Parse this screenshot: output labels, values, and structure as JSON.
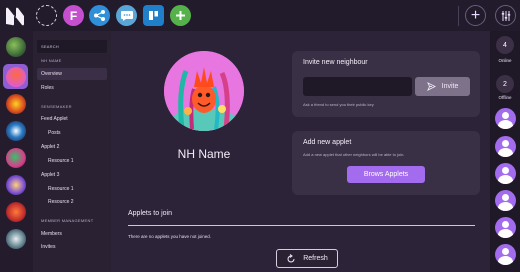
{
  "topbar": {
    "icons": [
      "neighbourhoods-logo",
      "add-dashed-icon",
      "f-app-icon",
      "share-app-icon",
      "chat-app-icon",
      "kanban-app-icon",
      "plus-app-icon"
    ]
  },
  "sidebar": {
    "search_label": "SEARCH",
    "nh_name_heading": "NH NAME",
    "overview": "Overview",
    "roles": "Roles",
    "sensemaker_heading": "SENSEMAKER",
    "feed_applet": "Feed Applet",
    "posts": "Posts",
    "applet2": "Applet 2",
    "applet2_resource1": "Resource 1",
    "applet3": "Applet 3",
    "applet3_resource1": "Resource 1",
    "applet3_resource2": "Resource 2",
    "member_heading": "MEMBER MANAGEMENT",
    "members": "Members",
    "invites": "Invites"
  },
  "main": {
    "nh_name": "NH Name",
    "invite": {
      "title": "Invite new neighbour",
      "input_placeholder": "",
      "button_label": "Invite",
      "help": "Ask a friend to send you their public key"
    },
    "add_applet": {
      "title": "Add new applet",
      "help": "Add a new applet that other neighbors will be able to join.",
      "button_label": "Brows Applets"
    },
    "applets_to_join": {
      "title": "Applets to join",
      "empty_text": "There are no applets you have not joined."
    },
    "refresh_label": "Refresh"
  },
  "right": {
    "online_count": "4",
    "online_label": "Online",
    "offline_count": "2",
    "offline_label": "Offline"
  },
  "colors": {
    "accent": "#a36bee",
    "background": "#2d2338"
  }
}
